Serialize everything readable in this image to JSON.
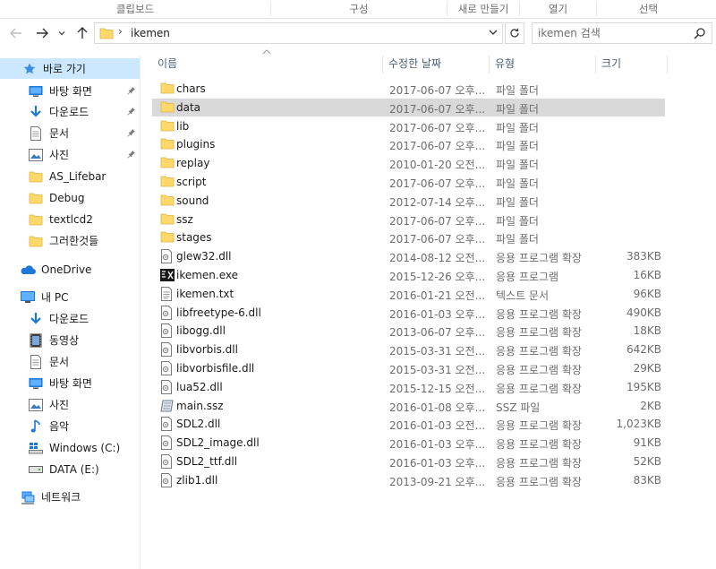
{
  "ribbon": {
    "groups": [
      "클립보드",
      "구성",
      "새로 만들기",
      "열기",
      "선택"
    ]
  },
  "address": {
    "path": "ikemen"
  },
  "search": {
    "placeholder": "ikemen 검색"
  },
  "nav": {
    "items": [
      {
        "label": "바로 가기",
        "icon": "quick-access-star-icon",
        "pinned": false,
        "selected": true
      },
      {
        "label": "바탕 화면",
        "icon": "desktop-icon",
        "pinned": true
      },
      {
        "label": "다운로드",
        "icon": "download-arrow-icon",
        "pinned": true
      },
      {
        "label": "문서",
        "icon": "document-icon",
        "pinned": true
      },
      {
        "label": "사진",
        "icon": "pictures-icon",
        "pinned": true
      },
      {
        "label": "AS_Lifebar",
        "icon": "folder-icon",
        "pinned": false
      },
      {
        "label": "Debug",
        "icon": "folder-icon",
        "pinned": false
      },
      {
        "label": "textlcd2",
        "icon": "folder-icon",
        "pinned": false
      },
      {
        "label": "그러한것들",
        "icon": "folder-icon",
        "pinned": false
      },
      {
        "label": "OneDrive",
        "icon": "onedrive-cloud-icon",
        "pinned": false
      },
      {
        "label": "내 PC",
        "icon": "this-pc-icon",
        "pinned": false
      },
      {
        "label": "다운로드",
        "icon": "download-arrow-icon",
        "pinned": false
      },
      {
        "label": "동영상",
        "icon": "video-icon",
        "pinned": false
      },
      {
        "label": "문서",
        "icon": "document-icon",
        "pinned": false
      },
      {
        "label": "바탕 화면",
        "icon": "desktop-icon",
        "pinned": false
      },
      {
        "label": "사진",
        "icon": "pictures-icon",
        "pinned": false
      },
      {
        "label": "음악",
        "icon": "music-note-icon",
        "pinned": false
      },
      {
        "label": "Windows (C:)",
        "icon": "windows-drive-icon",
        "pinned": false
      },
      {
        "label": "DATA (E:)",
        "icon": "drive-icon",
        "pinned": false
      },
      {
        "label": "네트워크",
        "icon": "network-icon",
        "pinned": false
      }
    ]
  },
  "columns": {
    "name": "이름",
    "date": "수정한 날짜",
    "type": "유형",
    "size": "크기"
  },
  "files": [
    {
      "name": "chars",
      "date": "2017-06-07 오후...",
      "type": "파일 폴더",
      "size": "",
      "icon": "folder-icon"
    },
    {
      "name": "data",
      "date": "2017-06-07 오후...",
      "type": "파일 폴더",
      "size": "",
      "icon": "folder-icon",
      "selected": true
    },
    {
      "name": "lib",
      "date": "2017-06-07 오후...",
      "type": "파일 폴더",
      "size": "",
      "icon": "folder-icon"
    },
    {
      "name": "plugins",
      "date": "2017-06-07 오후...",
      "type": "파일 폴더",
      "size": "",
      "icon": "folder-icon"
    },
    {
      "name": "replay",
      "date": "2010-01-20 오전...",
      "type": "파일 폴더",
      "size": "",
      "icon": "folder-icon"
    },
    {
      "name": "script",
      "date": "2017-06-07 오후...",
      "type": "파일 폴더",
      "size": "",
      "icon": "folder-icon"
    },
    {
      "name": "sound",
      "date": "2012-07-14 오후...",
      "type": "파일 폴더",
      "size": "",
      "icon": "folder-icon"
    },
    {
      "name": "ssz",
      "date": "2017-06-07 오후...",
      "type": "파일 폴더",
      "size": "",
      "icon": "folder-icon"
    },
    {
      "name": "stages",
      "date": "2017-06-07 오후...",
      "type": "파일 폴더",
      "size": "",
      "icon": "folder-icon"
    },
    {
      "name": "glew32.dll",
      "date": "2014-08-12 오전...",
      "type": "응용 프로그램 확장",
      "size": "383KB",
      "icon": "dll-file-icon"
    },
    {
      "name": "ikemen.exe",
      "date": "2015-12-26 오후...",
      "type": "응용 프로그램",
      "size": "16KB",
      "icon": "exe-app-icon"
    },
    {
      "name": "ikemen.txt",
      "date": "2016-01-21 오전...",
      "type": "텍스트 문서",
      "size": "96KB",
      "icon": "text-file-icon"
    },
    {
      "name": "libfreetype-6.dll",
      "date": "2016-01-03 오후...",
      "type": "응용 프로그램 확장",
      "size": "490KB",
      "icon": "dll-file-icon"
    },
    {
      "name": "libogg.dll",
      "date": "2013-06-07 오후...",
      "type": "응용 프로그램 확장",
      "size": "18KB",
      "icon": "dll-file-icon"
    },
    {
      "name": "libvorbis.dll",
      "date": "2015-03-31 오전...",
      "type": "응용 프로그램 확장",
      "size": "642KB",
      "icon": "dll-file-icon"
    },
    {
      "name": "libvorbisfile.dll",
      "date": "2015-03-31 오전...",
      "type": "응용 프로그램 확장",
      "size": "29KB",
      "icon": "dll-file-icon"
    },
    {
      "name": "lua52.dll",
      "date": "2015-12-15 오전...",
      "type": "응용 프로그램 확장",
      "size": "195KB",
      "icon": "dll-file-icon"
    },
    {
      "name": "main.ssz",
      "date": "2016-01-08 오후...",
      "type": "SSZ 파일",
      "size": "2KB",
      "icon": "ssz-file-icon"
    },
    {
      "name": "SDL2.dll",
      "date": "2016-01-03 오전...",
      "type": "응용 프로그램 확장",
      "size": "1,023KB",
      "icon": "dll-file-icon"
    },
    {
      "name": "SDL2_image.dll",
      "date": "2016-01-03 오후...",
      "type": "응용 프로그램 확장",
      "size": "91KB",
      "icon": "dll-file-icon"
    },
    {
      "name": "SDL2_ttf.dll",
      "date": "2016-01-03 오후...",
      "type": "응용 프로그램 확장",
      "size": "52KB",
      "icon": "dll-file-icon"
    },
    {
      "name": "zlib1.dll",
      "date": "2013-09-21 오후...",
      "type": "응용 프로그램 확장",
      "size": "83KB",
      "icon": "dll-file-icon"
    }
  ],
  "colors": {
    "selected_nav": "#cce8ff",
    "selected_row": "#d9d9d9",
    "folder": "#ffd86b",
    "accent": "#1e78d7"
  }
}
